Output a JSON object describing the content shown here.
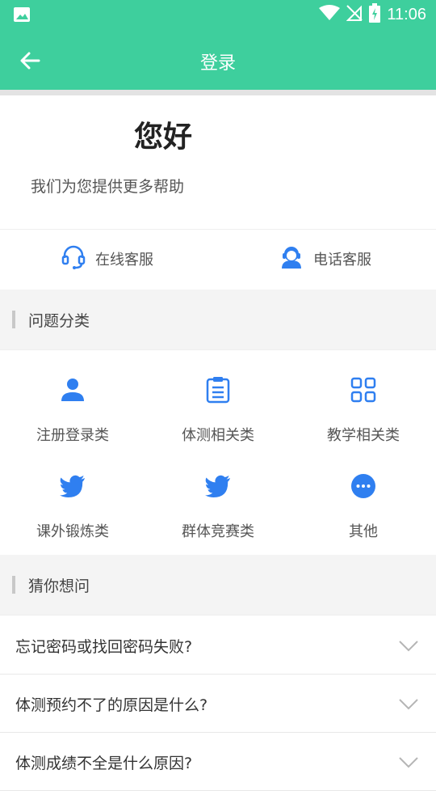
{
  "status_bar": {
    "time": "11:06"
  },
  "header": {
    "title": "登录"
  },
  "greeting": {
    "title": "您好",
    "subtitle": "我们为您提供更多帮助"
  },
  "services": [
    {
      "label": "在线客服",
      "icon": "headset-icon"
    },
    {
      "label": "电话客服",
      "icon": "agent-icon"
    }
  ],
  "categories_section": {
    "title": "问题分类"
  },
  "categories": [
    {
      "label": "注册登录类",
      "icon": "person-icon"
    },
    {
      "label": "体测相关类",
      "icon": "clipboard-icon"
    },
    {
      "label": "教学相关类",
      "icon": "grid-icon"
    },
    {
      "label": "课外锻炼类",
      "icon": "bird-icon"
    },
    {
      "label": "群体竞赛类",
      "icon": "bird-icon"
    },
    {
      "label": "其他",
      "icon": "more-icon"
    }
  ],
  "faq_section": {
    "title": "猜你想问"
  },
  "faq": [
    {
      "question": "忘记密码或找回密码失败?"
    },
    {
      "question": "体测预约不了的原因是什么?"
    },
    {
      "question": "体测成绩不全是什么原因?"
    }
  ],
  "colors": {
    "brand": "#3ecf9d",
    "accent": "#2f7ff0"
  }
}
